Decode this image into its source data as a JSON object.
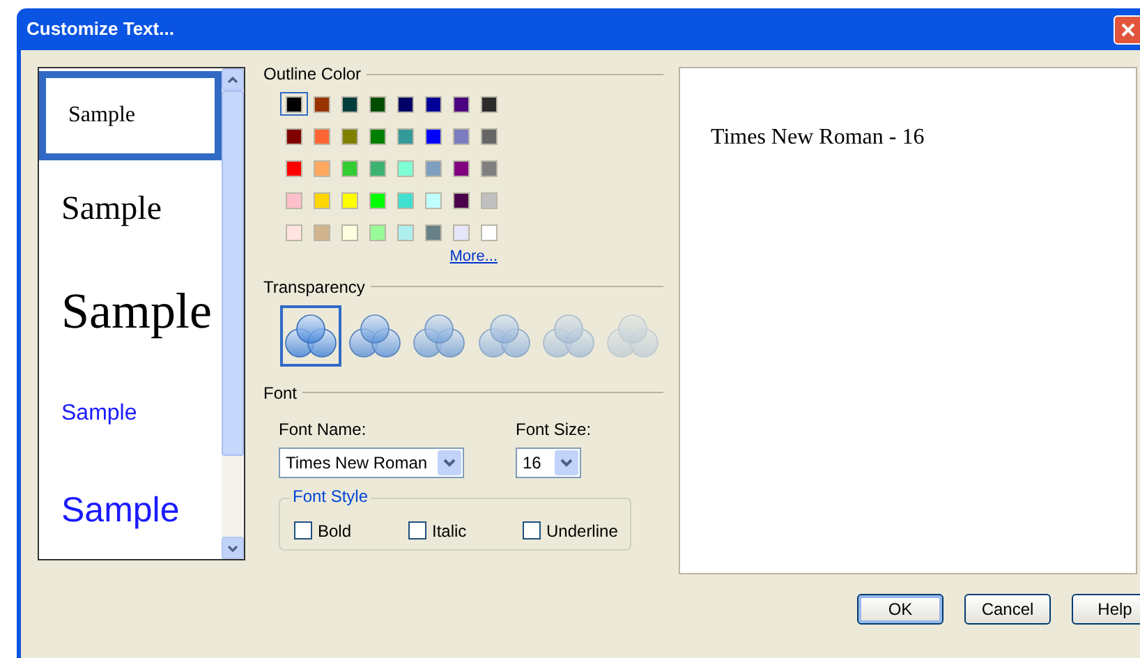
{
  "window": {
    "title": "Customize Text..."
  },
  "samples": [
    {
      "text": "Sample",
      "kind": "serif-small",
      "color": "#000000",
      "selected": true
    },
    {
      "text": "Sample",
      "kind": "serif-medium",
      "color": "#000000",
      "selected": false
    },
    {
      "text": "Sample",
      "kind": "serif-large",
      "color": "#000000",
      "selected": false
    },
    {
      "text": "Sample",
      "kind": "sans-small",
      "color": "#1a1aff",
      "selected": false
    },
    {
      "text": "Sample",
      "kind": "sans-large",
      "color": "#1a1aff",
      "selected": false
    }
  ],
  "outline_color": {
    "label": "Outline Color",
    "more_link": "More...",
    "swatches": [
      {
        "color": "#000000",
        "selected": true
      },
      {
        "color": "#993300",
        "selected": false
      },
      {
        "color": "#003d3d",
        "selected": false
      },
      {
        "color": "#004d00",
        "selected": false
      },
      {
        "color": "#000066",
        "selected": false
      },
      {
        "color": "#000099",
        "selected": false
      },
      {
        "color": "#4b0082",
        "selected": false
      },
      {
        "color": "#2b2b2b",
        "selected": false
      },
      {
        "color": "#800000",
        "selected": false
      },
      {
        "color": "#ff6633",
        "selected": false
      },
      {
        "color": "#808000",
        "selected": false
      },
      {
        "color": "#008000",
        "selected": false
      },
      {
        "color": "#339999",
        "selected": false
      },
      {
        "color": "#0000ff",
        "selected": false
      },
      {
        "color": "#7b7bc0",
        "selected": false
      },
      {
        "color": "#666666",
        "selected": false
      },
      {
        "color": "#ff0000",
        "selected": false
      },
      {
        "color": "#ffa860",
        "selected": false
      },
      {
        "color": "#33cc33",
        "selected": false
      },
      {
        "color": "#3cb371",
        "selected": false
      },
      {
        "color": "#7fffd4",
        "selected": false
      },
      {
        "color": "#7f9fc0",
        "selected": false
      },
      {
        "color": "#800080",
        "selected": false
      },
      {
        "color": "#808080",
        "selected": false
      },
      {
        "color": "#ffc0cb",
        "selected": false
      },
      {
        "color": "#ffd700",
        "selected": false
      },
      {
        "color": "#ffff00",
        "selected": false
      },
      {
        "color": "#00ff00",
        "selected": false
      },
      {
        "color": "#40e0d0",
        "selected": false
      },
      {
        "color": "#c0ffff",
        "selected": false
      },
      {
        "color": "#4a004a",
        "selected": false
      },
      {
        "color": "#c0c0c0",
        "selected": false
      },
      {
        "color": "#ffe4e1",
        "selected": false
      },
      {
        "color": "#d2b48c",
        "selected": false
      },
      {
        "color": "#ffffe0",
        "selected": false
      },
      {
        "color": "#98fb98",
        "selected": false
      },
      {
        "color": "#afeeee",
        "selected": false
      },
      {
        "color": "#688088",
        "selected": false
      },
      {
        "color": "#e6e6fa",
        "selected": false
      },
      {
        "color": "#ffffff",
        "selected": false
      }
    ]
  },
  "transparency": {
    "label": "Transparency",
    "options": [
      {
        "selected": true
      },
      {
        "selected": false
      },
      {
        "selected": false
      },
      {
        "selected": false
      },
      {
        "selected": false
      },
      {
        "selected": false
      }
    ]
  },
  "font": {
    "label": "Font",
    "font_name": {
      "label": "Font Name:",
      "value": "Times New Roman"
    },
    "font_size": {
      "label": "Font Size:",
      "value": "16"
    },
    "font_style": {
      "label": "Font Style",
      "options": [
        {
          "label": "Bold",
          "checked": false
        },
        {
          "label": "Italic",
          "checked": false
        },
        {
          "label": "Underline",
          "checked": false
        }
      ]
    }
  },
  "preview": {
    "text": "Times New Roman - 16"
  },
  "buttons": [
    {
      "label": "OK",
      "selected": true
    },
    {
      "label": "Cancel",
      "selected": false
    },
    {
      "label": "Help",
      "selected": false
    }
  ]
}
